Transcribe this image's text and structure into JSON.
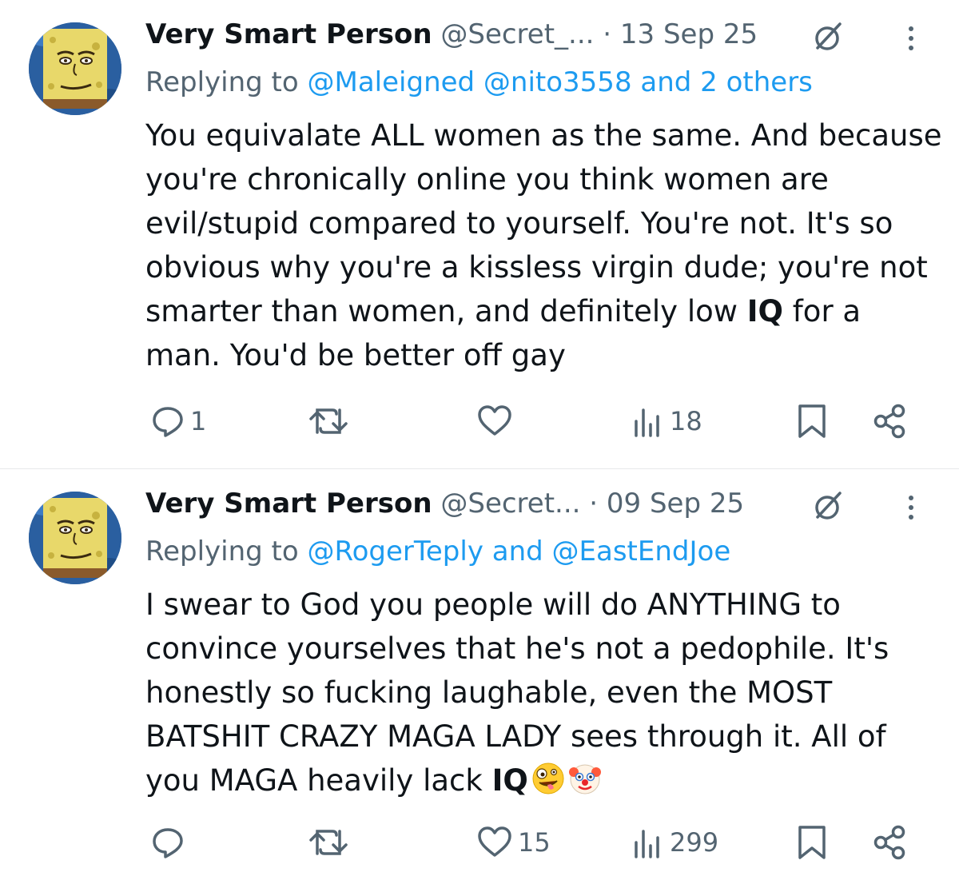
{
  "tweets": [
    {
      "display_name": "Very Smart Person",
      "handle": "@Secret_...",
      "separator": "·",
      "date": "13 Sep 25",
      "replying_prefix": "Replying to",
      "replying_mentions": "@Maleigned @nito3558 and 2 others",
      "body_before": "You equivalate ALL women as the same. And because you're chronically online you think women are evil/stupid compared to yourself. You're not. It's so obvious why you're a kissless virgin dude; you're not smarter than women, and definitely low ",
      "body_bold": "IQ",
      "body_after": " for a man. You'd be better off gay",
      "emojis": [],
      "reply_count": "1",
      "retweet_count": "",
      "like_count": "",
      "view_count": "18",
      "icons": [
        "grok-icon",
        "more-icon",
        "reply-icon",
        "retweet-icon",
        "like-icon",
        "views-icon",
        "bookmark-icon",
        "share-icon"
      ]
    },
    {
      "display_name": "Very Smart Person",
      "handle": "@Secret...",
      "separator": "·",
      "date": "09 Sep 25",
      "replying_prefix": "Replying to",
      "replying_mentions": "@RogerTeply and @EastEndJoe",
      "body_before": "I swear to God you people will do ANYTHING to convince yourselves that he's not a pedophile. It's honestly so fucking laughable, even the MOST BATSHIT CRAZY MAGA LADY sees through it. All of you MAGA heavily lack ",
      "body_bold": "IQ",
      "body_after": "",
      "emojis": [
        "zany-face-emoji",
        "clown-face-emoji"
      ],
      "reply_count": "",
      "retweet_count": "",
      "like_count": "15",
      "view_count": "299",
      "icons": [
        "grok-icon",
        "more-icon",
        "reply-icon",
        "retweet-icon",
        "like-icon",
        "views-icon",
        "bookmark-icon",
        "share-icon"
      ]
    }
  ],
  "colors": {
    "text": "#0f1419",
    "secondary": "#536471",
    "link": "#1d9bf0",
    "divider": "#e7e9ea"
  }
}
